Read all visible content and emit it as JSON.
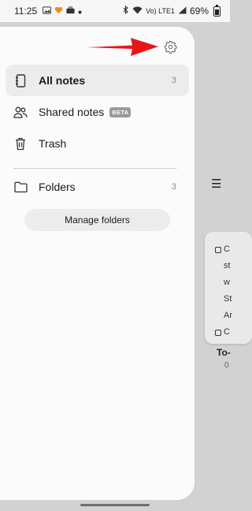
{
  "status_bar": {
    "time": "11:25",
    "battery": "69%",
    "network_label": "Vo) LTE1",
    "icons": [
      "image-icon",
      "heart-icon",
      "briefcase-icon",
      "dot-icon",
      "bluetooth-icon",
      "wifi-icon",
      "signal-icon",
      "battery-icon"
    ]
  },
  "drawer": {
    "settings_icon": "gear-icon",
    "nav": [
      {
        "label": "All notes",
        "count": "3",
        "icon": "notebook-icon",
        "active": true
      },
      {
        "label": "Shared notes",
        "badge": "BETA",
        "icon": "people-icon"
      },
      {
        "label": "Trash",
        "icon": "trash-icon"
      },
      {
        "label": "Folders",
        "count": "3",
        "icon": "folder-icon"
      }
    ],
    "manage_folders": "Manage folders"
  },
  "background_app": {
    "menu_icon": "hamburger-icon",
    "note_lines": [
      "C",
      "st",
      "w",
      "St",
      "Ar",
      "C"
    ],
    "note_title": "To-",
    "note_date": "0"
  },
  "colors": {
    "drawer_bg": "#fbfbfb",
    "active_item_bg": "#ececec",
    "arrow_red": "#e8161b",
    "backdrop": "#d2d2d2"
  }
}
